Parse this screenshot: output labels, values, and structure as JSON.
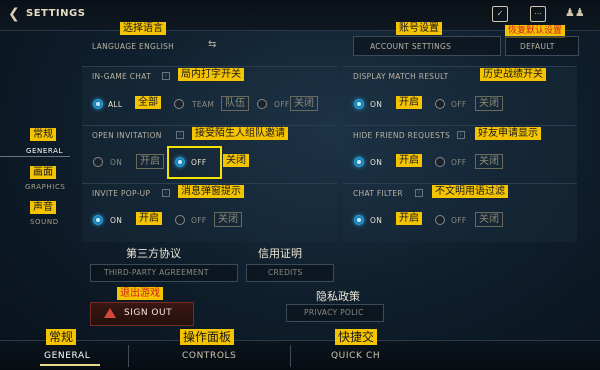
{
  "header": {
    "title": "SETTINGS"
  },
  "language": {
    "annotation": "选择语言",
    "label": "LANGUAGE ENGLISH"
  },
  "account": {
    "annotation": "账号设置",
    "button": "ACCOUNT SETTINGS"
  },
  "default": {
    "annotation": "恢复默认设置",
    "button": "DEFAULT"
  },
  "sidebar": {
    "general": {
      "annotation": "常规",
      "label": "GENERAL"
    },
    "graphics": {
      "annotation": "画面",
      "label": "GRAPHICS"
    },
    "sound": {
      "annotation": "声音",
      "label": "SOUND"
    }
  },
  "settings": {
    "ingame_chat": {
      "label": "IN-GAME CHAT",
      "annotation": "局内打字开关",
      "options": [
        {
          "label": "ALL",
          "annotation": "全部",
          "selected": true
        },
        {
          "label": "TEAM",
          "annotation": "队伍",
          "selected": false
        },
        {
          "label": "OFF",
          "annotation": "关闭",
          "selected": false
        }
      ]
    },
    "display_match": {
      "label": "DISPLAY MATCH RESULT",
      "annotation": "历史战绩开关",
      "options": [
        {
          "label": "ON",
          "annotation": "开启",
          "selected": true
        },
        {
          "label": "OFF",
          "annotation": "关闭",
          "selected": false
        }
      ]
    },
    "open_invitation": {
      "label": "OPEN INVITATION",
      "annotation": "接受陌生人组队邀请",
      "options": [
        {
          "label": "ON",
          "annotation": "开启",
          "selected": false
        },
        {
          "label": "OFF",
          "annotation": "关闭",
          "selected": true
        }
      ]
    },
    "hide_friend": {
      "label": "HIDE FRIEND REQUESTS",
      "annotation": "好友申请显示",
      "options": [
        {
          "label": "ON",
          "annotation": "开启",
          "selected": true
        },
        {
          "label": "OFF",
          "annotation": "关闭",
          "selected": false
        }
      ]
    },
    "invite_popup": {
      "label": "INVITE POP-UP",
      "annotation": "消息弹窗提示",
      "options": [
        {
          "label": "ON",
          "annotation": "开启",
          "selected": true
        },
        {
          "label": "OFF",
          "annotation": "关闭",
          "selected": false
        }
      ]
    },
    "chat_filter": {
      "label": "CHAT FILTER",
      "annotation": "不文明用语过滤",
      "options": [
        {
          "label": "ON",
          "annotation": "开启",
          "selected": true
        },
        {
          "label": "OFF",
          "annotation": "关闭",
          "selected": false
        }
      ]
    }
  },
  "links": {
    "third_party": {
      "annotation": "第三方协议",
      "label": "THIRD-PARTY AGREEMENT"
    },
    "credits": {
      "annotation": "信用证明",
      "label": "CREDITS"
    },
    "privacy": {
      "annotation": "隐私政策",
      "label": "PRIVACY POLIC"
    }
  },
  "signout": {
    "annotation": "退出游戏",
    "label": "SIGN OUT"
  },
  "bottom_tabs": [
    {
      "annotation": "常规",
      "label": "GENERAL"
    },
    {
      "annotation": "操作面板",
      "label": "CONTROLS"
    },
    {
      "annotation": "快捷交",
      "label": "QUICK CH"
    }
  ],
  "colors": {
    "accent": "#2aa6e0",
    "annotation_bg": "#f5c400",
    "highlight": "#f2e400"
  }
}
